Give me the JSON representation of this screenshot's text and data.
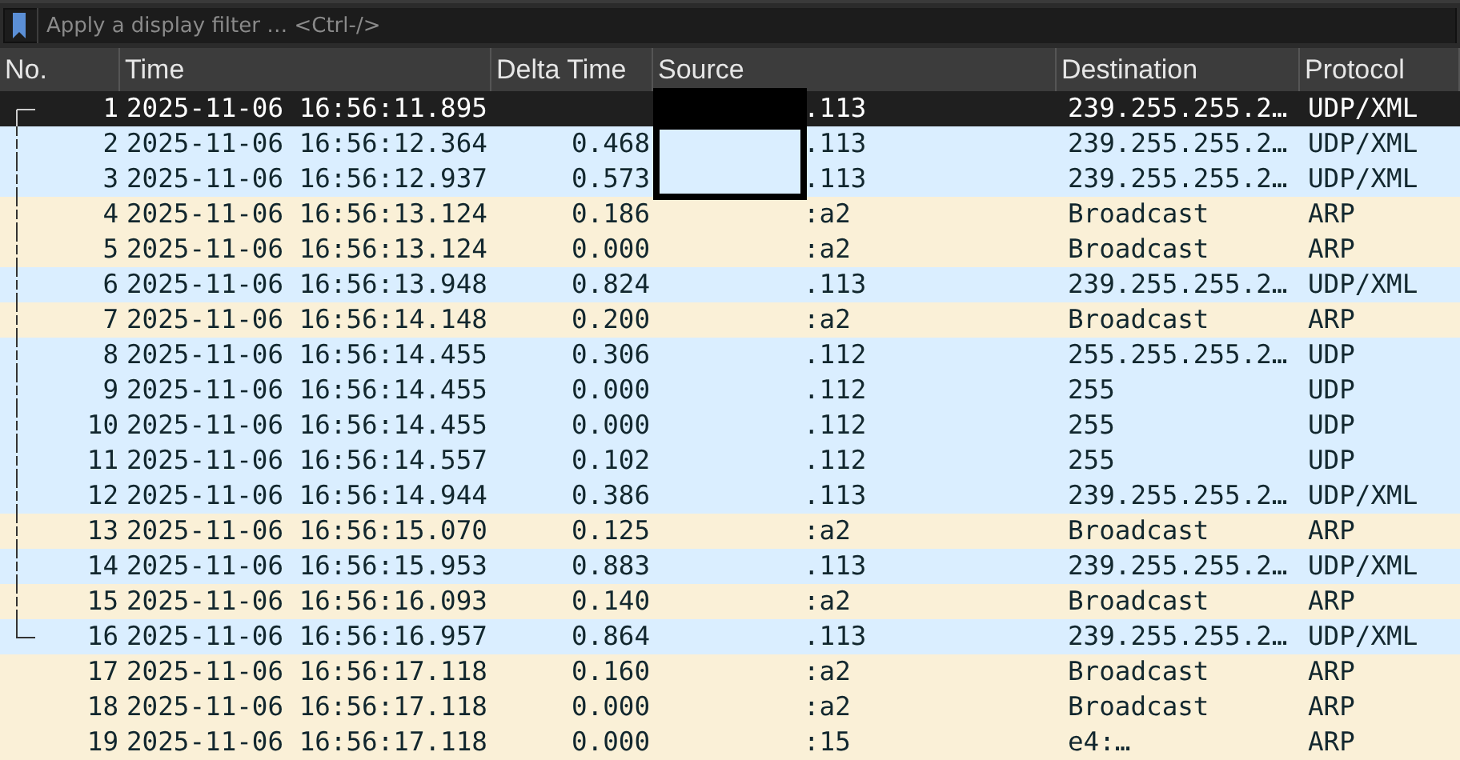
{
  "filter": {
    "placeholder": "Apply a display filter … <Ctrl-/>"
  },
  "columns": [
    "No.",
    "Time",
    "Delta Time",
    "Source",
    "Destination",
    "Protocol"
  ],
  "packets": [
    {
      "no": "1",
      "time": "2025-11-06 16:56:11.895",
      "source": ".113",
      "destination": "239.255.255.2…",
      "protocol": "UDP/XML",
      "kind": "udp",
      "selected": true,
      "related": true
    },
    {
      "no": "2",
      "time": "2025-11-06 16:56:12.364",
      "delta": "0.468",
      "source": ".113",
      "destination": "239.255.255.2…",
      "protocol": "UDP/XML",
      "kind": "udp",
      "selected": false,
      "related": true
    },
    {
      "no": "3",
      "time": "2025-11-06 16:56:12.937",
      "delta": "0.573",
      "source": ".113",
      "destination": "239.255.255.2…",
      "protocol": "UDP/XML",
      "kind": "udp",
      "selected": false,
      "related": true
    },
    {
      "no": "4",
      "time": "2025-11-06 16:56:13.124",
      "delta": "0.186",
      "source": ":a2",
      "destination": "Broadcast",
      "protocol": "ARP",
      "kind": "arp",
      "selected": false,
      "related": true
    },
    {
      "no": "5",
      "time": "2025-11-06 16:56:13.124",
      "delta": "0.000",
      "source": ":a2",
      "destination": "Broadcast",
      "protocol": "ARP",
      "kind": "arp",
      "selected": false,
      "related": true
    },
    {
      "no": "6",
      "time": "2025-11-06 16:56:13.948",
      "delta": "0.824",
      "source": ".113",
      "destination": "239.255.255.2…",
      "protocol": "UDP/XML",
      "kind": "udp",
      "selected": false,
      "related": true
    },
    {
      "no": "7",
      "time": "2025-11-06 16:56:14.148",
      "delta": "0.200",
      "source": ":a2",
      "destination": "Broadcast",
      "protocol": "ARP",
      "kind": "arp",
      "selected": false,
      "related": true
    },
    {
      "no": "8",
      "time": "2025-11-06 16:56:14.455",
      "delta": "0.306",
      "source": ".112",
      "destination": "255.255.255.2…",
      "protocol": "UDP",
      "kind": "udp",
      "selected": false,
      "related": true
    },
    {
      "no": "9",
      "time": "2025-11-06 16:56:14.455",
      "delta": "0.000",
      "source": ".112",
      "destination": "255",
      "protocol": "UDP",
      "kind": "udp",
      "selected": false,
      "related": true
    },
    {
      "no": "10",
      "time": "2025-11-06 16:56:14.455",
      "delta": "0.000",
      "source": ".112",
      "destination": "255",
      "protocol": "UDP",
      "kind": "udp",
      "selected": false,
      "related": true
    },
    {
      "no": "11",
      "time": "2025-11-06 16:56:14.557",
      "delta": "0.102",
      "source": ".112",
      "destination": "255",
      "protocol": "UDP",
      "kind": "udp",
      "selected": false,
      "related": true
    },
    {
      "no": "12",
      "time": "2025-11-06 16:56:14.944",
      "delta": "0.386",
      "source": ".113",
      "destination": "239.255.255.2…",
      "protocol": "UDP/XML",
      "kind": "udp",
      "selected": false,
      "related": true
    },
    {
      "no": "13",
      "time": "2025-11-06 16:56:15.070",
      "delta": "0.125",
      "source": ":a2",
      "destination": "Broadcast",
      "protocol": "ARP",
      "kind": "arp",
      "selected": false,
      "related": true
    },
    {
      "no": "14",
      "time": "2025-11-06 16:56:15.953",
      "delta": "0.883",
      "source": ".113",
      "destination": "239.255.255.2…",
      "protocol": "UDP/XML",
      "kind": "udp",
      "selected": false,
      "related": true
    },
    {
      "no": "15",
      "time": "2025-11-06 16:56:16.093",
      "delta": "0.140",
      "source": ":a2",
      "destination": "Broadcast",
      "protocol": "ARP",
      "kind": "arp",
      "selected": false,
      "related": true
    },
    {
      "no": "16",
      "time": "2025-11-06 16:56:16.957",
      "delta": "0.864",
      "source": ".113",
      "destination": "239.255.255.2…",
      "protocol": "UDP/XML",
      "kind": "udp",
      "selected": false,
      "related": true
    },
    {
      "no": "17",
      "time": "2025-11-06 16:56:17.118",
      "delta": "0.160",
      "source": ":a2",
      "destination": "Broadcast",
      "protocol": "ARP",
      "kind": "arp",
      "selected": false,
      "related": false
    },
    {
      "no": "18",
      "time": "2025-11-06 16:56:17.118",
      "delta": "0.000",
      "source": ":a2",
      "destination": "Broadcast",
      "protocol": "ARP",
      "kind": "arp",
      "selected": false,
      "related": false
    },
    {
      "no": "19",
      "time": "2025-11-06 16:56:17.118",
      "delta": "0.000",
      "source": ":15",
      "destination": "e4:…",
      "protocol": "ARP",
      "kind": "arp",
      "selected": false,
      "related": false
    }
  ]
}
